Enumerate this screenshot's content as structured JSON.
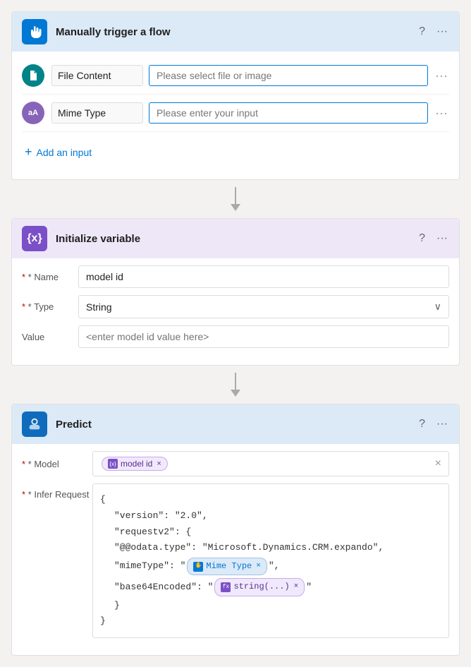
{
  "trigger": {
    "title": "Manually trigger a flow",
    "icon_color": "#0078d4",
    "icon_label": "✋",
    "inputs": [
      {
        "id": "file-content",
        "type_icon": "D",
        "type_color": "#038387",
        "label": "File Content",
        "placeholder": "Please select file or image"
      },
      {
        "id": "mime-type",
        "type_icon": "aA",
        "type_color": "#8764b8",
        "label": "Mime Type",
        "placeholder": "Please enter your input"
      }
    ],
    "add_input_label": "Add an input"
  },
  "init_variable": {
    "title": "Initialize variable",
    "name_label": "* Name",
    "name_value": "model id",
    "type_label": "* Type",
    "type_value": "String",
    "value_label": "Value",
    "value_placeholder": "<enter model id value here>"
  },
  "predict": {
    "title": "Predict",
    "model_label": "* Model",
    "model_tag_icon": "{x}",
    "model_tag_label": "model id",
    "infer_label": "* Infer Request",
    "code": [
      {
        "indent": 0,
        "text": "{"
      },
      {
        "indent": 1,
        "text": "\"version\": \"2.0\","
      },
      {
        "indent": 1,
        "text": "\"requestv2\": {"
      },
      {
        "indent": 1,
        "text": "\"@@odata.type\": \"Microsoft.Dynamics.CRM.expando\","
      },
      {
        "indent": 1,
        "text_before": "\"mimeType\": \"",
        "tag_type": "blue",
        "tag_icon": "✋",
        "tag_label": "Mime Type",
        "text_after": "\","
      },
      {
        "indent": 1,
        "text_before": "\"base64Encoded\": \"",
        "tag_type": "purple",
        "tag_icon": "fx",
        "tag_label": "string(...)",
        "text_after": "\""
      },
      {
        "indent": 0,
        "text": "}"
      },
      {
        "indent": 0,
        "text": "}"
      }
    ]
  },
  "icons": {
    "question_mark": "?",
    "ellipsis": "···",
    "chevron_down": "∨",
    "plus": "+",
    "close": "×",
    "arrow_down": "↓"
  }
}
